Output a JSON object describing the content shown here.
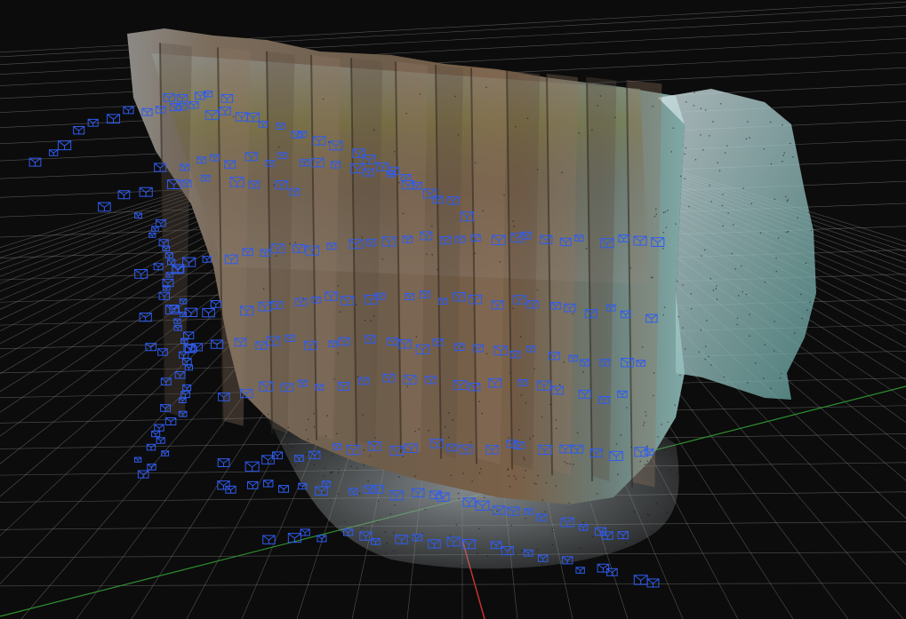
{
  "viewport": {
    "background": "#0c0c0c",
    "grid_color": "#8a8a8a",
    "x_axis_color": "#2f8f2f",
    "y_axis_color": "#c83232",
    "camera_color": "#2e5cf0"
  },
  "model": {
    "rock_light": "#9a8a78",
    "rock_dark": "#4e4438",
    "moss": "#7d7a3e",
    "water_tint": "#6fa7a3",
    "haze": "#c9d6da"
  },
  "icons": {
    "camera_frustum": "camera-frustum-icon",
    "tie_point": "tie-point-icon"
  }
}
